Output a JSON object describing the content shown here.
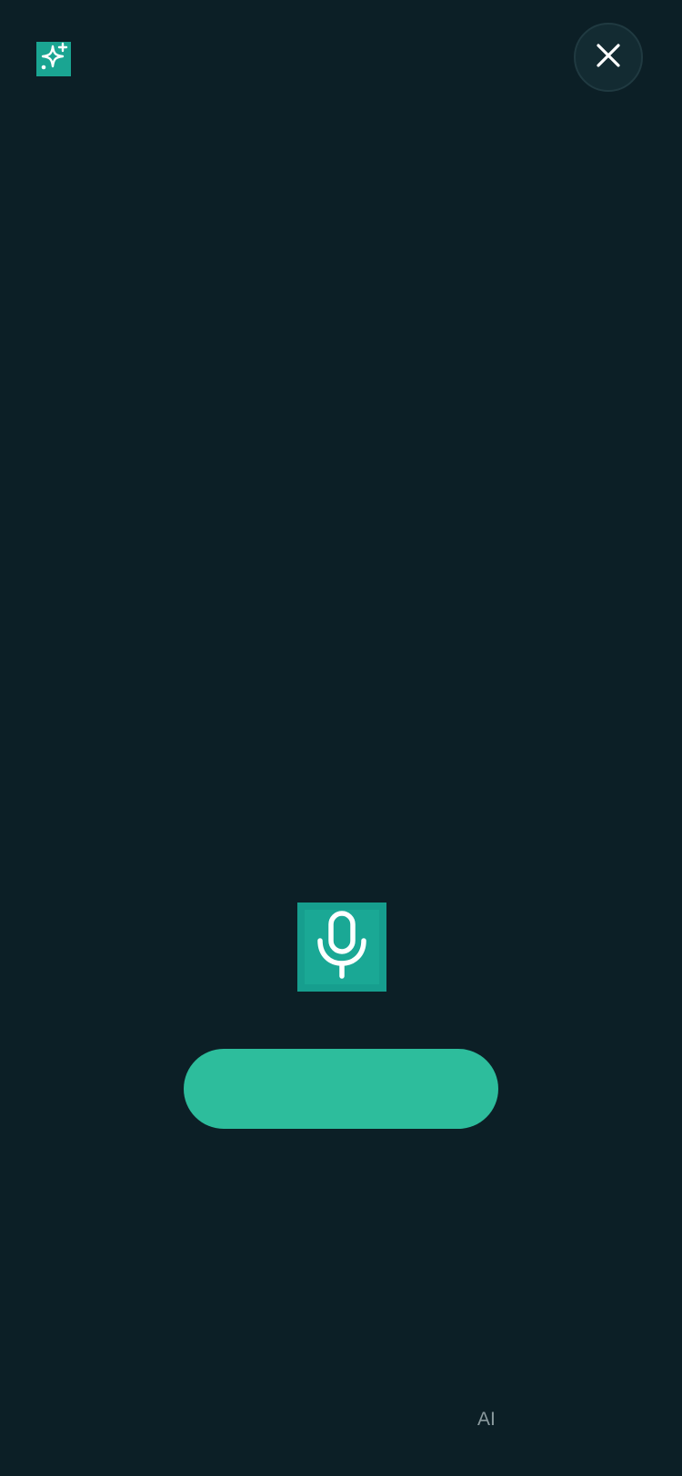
{
  "header": {
    "logo_icon": "sparkles-icon",
    "close_icon": "close-icon"
  },
  "voice": {
    "mic_icon": "microphone-icon",
    "action_label": ""
  },
  "footer": {
    "ai_label": "AI"
  },
  "colors": {
    "background": "#0c1f26",
    "accent": "#1aa592",
    "pill": "#2dbd9c",
    "close_button_bg": "#132b32"
  }
}
